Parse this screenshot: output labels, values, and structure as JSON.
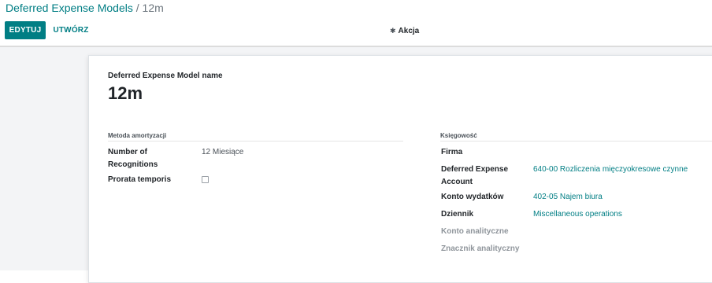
{
  "breadcrumb": {
    "parent": "Deferred Expense Models",
    "separator": "/",
    "current": "12m"
  },
  "toolbar": {
    "edit_label": "EDYTUJ",
    "create_label": "UTWÓRZ",
    "action_label": "Akcja",
    "action_icon": "gear-icon"
  },
  "form": {
    "name_label": "Deferred Expense Model name",
    "name_value": "12m",
    "depreciation": {
      "title": "Metoda amortyzacji",
      "recognitions_label_1": "Number of",
      "recognitions_label_2": "Recognitions",
      "recognitions_value": "12",
      "recognitions_unit": "Miesiące",
      "prorata_label": "Prorata temporis",
      "prorata_checked": false
    },
    "accounting": {
      "title": "Księgowość",
      "company_label": "Firma",
      "deferred_label_1": "Deferred Expense",
      "deferred_label_2": "Account",
      "deferred_value": "640-00 Rozliczenia mięczyokresowe czynne",
      "expense_label": "Konto wydatków",
      "expense_value": "402-05 Najem biura",
      "journal_label": "Dziennik",
      "journal_value": "Miscellaneous operations",
      "analytic_account_label": "Konto analityczne",
      "analytic_tag_label": "Znacznik analityczny"
    }
  },
  "colors": {
    "primary": "#017e84",
    "background": "#f3f4f6"
  }
}
